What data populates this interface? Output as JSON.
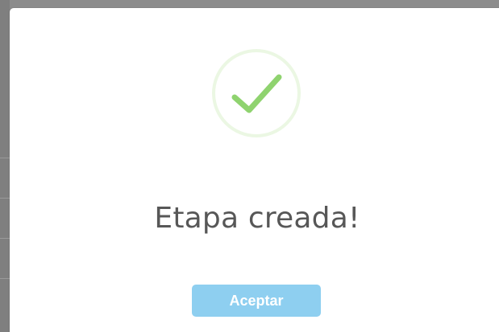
{
  "dialog": {
    "title": "Etapa creada!",
    "confirm_label": "Aceptar",
    "icon": "check-circle-icon"
  },
  "colors": {
    "success_ring": "#ebf7e3",
    "success_check": "#8fd36f",
    "title_text": "#575757",
    "button_bg": "#8ecff0",
    "button_text": "#ffffff",
    "overlay": "#8c8c8c"
  }
}
